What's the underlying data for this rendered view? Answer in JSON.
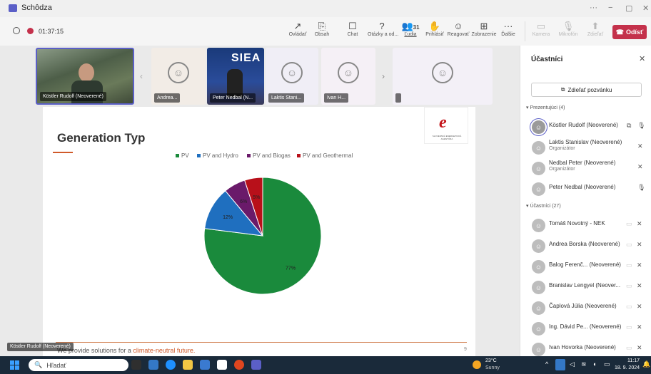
{
  "window": {
    "title": "Schôdza",
    "minimize_icon": "minimize-icon",
    "maximize_icon": "maximize-icon",
    "close_icon": "close-icon",
    "more": "···",
    "min_char": "−",
    "max_char": "▢",
    "close_char": "✕"
  },
  "meeting": {
    "timer": "01:37:15"
  },
  "toolbar": {
    "items": [
      {
        "label": "Ovládať",
        "icon": "↗"
      },
      {
        "label": "Obsah",
        "icon": "⎘"
      },
      {
        "label": "Chat",
        "icon": "☐"
      },
      {
        "label": "Otázky a od...",
        "icon": "?"
      },
      {
        "label": "Ľudia",
        "icon": "👥",
        "count": "31"
      },
      {
        "label": "Prihlásiť",
        "icon": "✋"
      },
      {
        "label": "Reagovať",
        "icon": "☺"
      },
      {
        "label": "Zobrazenie",
        "icon": "⊞"
      },
      {
        "label": "Ďalšie",
        "icon": "···"
      }
    ],
    "media": [
      {
        "label": "Kamera",
        "icon": "▭"
      },
      {
        "label": "Mikrofón",
        "icon": "🎙"
      },
      {
        "label": "Zdieľať",
        "icon": "⬆"
      }
    ],
    "leave_label": "Odísť",
    "leave_icon": "☎"
  },
  "tiles": [
    {
      "name": "Köstler Rudolf (Neoverené)"
    },
    {
      "name": "Andrea..."
    },
    {
      "name": "Peter Nedbal (N..."
    },
    {
      "name": "Laktis Stani..."
    },
    {
      "name": "Ivan H..."
    },
    {
      "name": ""
    }
  ],
  "tile_logo_text": "SIEA",
  "slide": {
    "title": "Generation Typ",
    "footer_text": "We provide solutions for a ",
    "footer_highlight": "climate-neutral future.",
    "page_number": "9",
    "logo_text": "SLOVENSKÁ ENERGETICKÁ AGENTÚRA",
    "presenter_label": "Köstler Rudolf (Neoverené)"
  },
  "chart_data": {
    "type": "pie",
    "title": "",
    "categories": [
      "PV",
      "PV and Hydro",
      "PV and Biogas",
      "PV and Geothermal"
    ],
    "values": [
      77,
      12,
      6,
      5
    ],
    "labels": [
      "77%",
      "12%",
      "6%",
      "5%"
    ],
    "colors": [
      "#1a8a3c",
      "#1f6fbf",
      "#6a1a6a",
      "#b8101a"
    ],
    "legend_position": "top"
  },
  "panel": {
    "title": "Účastníci",
    "invite_label": "Zdieľať pozvánku",
    "presenters_header": "Prezentujúci (4)",
    "attendees_header": "Účastníci (27)",
    "presenters": [
      {
        "name": "Köstler Rudolf (Neoverené)",
        "sub": ""
      },
      {
        "name": "Laktis Stanislav (Neoverené)",
        "sub": "Organizátor"
      },
      {
        "name": "Nedbal Peter (Neoverené)",
        "sub": "Organizátor"
      },
      {
        "name": "Peter Nedbal (Neoverené)",
        "sub": ""
      }
    ],
    "attendees": [
      {
        "name": "Tomáš Novotný - NEK"
      },
      {
        "name": "Andrea Borska (Neoverené)"
      },
      {
        "name": "Balog Ferenč... (Neoverené)"
      },
      {
        "name": "Branislav Lengyel (Neover..."
      },
      {
        "name": "Čaplová Júlia (Neoverené)"
      },
      {
        "name": "Ing. Dávid Pe... (Neoverené)"
      },
      {
        "name": "Ivan Hovorka (Neoverené)"
      }
    ]
  },
  "taskbar": {
    "search_placeholder": "Hľadať",
    "weather_temp": "23°C",
    "weather_desc": "Sunny",
    "time": "11:17",
    "date": "18. 9. 2024"
  }
}
